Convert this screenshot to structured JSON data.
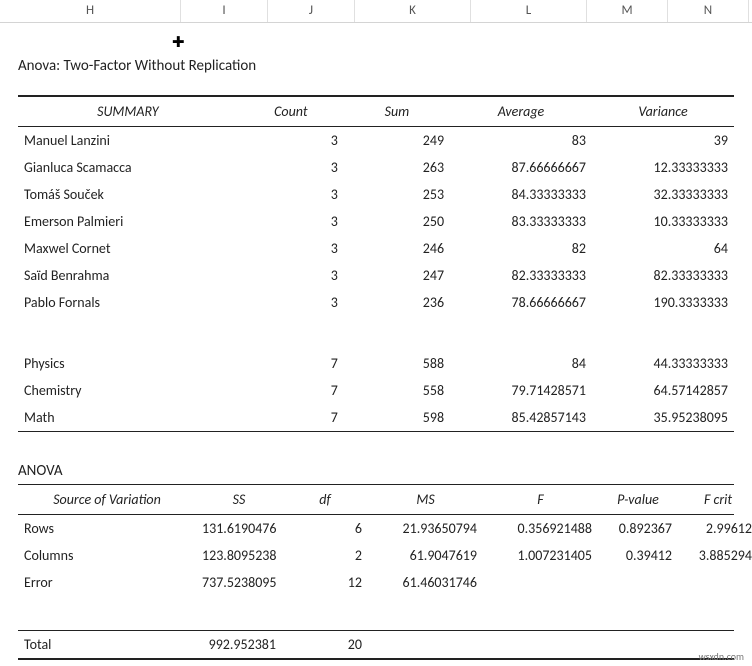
{
  "columns": {
    "H": "H",
    "I": "I",
    "J": "J",
    "K": "K",
    "L": "L",
    "M": "M",
    "N": "N"
  },
  "title": "Anova: Two-Factor Without Replication",
  "summary": {
    "headers": {
      "label": "SUMMARY",
      "count": "Count",
      "sum": "Sum",
      "avg": "Average",
      "var": "Variance"
    },
    "rows": [
      {
        "name": "Manuel Lanzini",
        "count": "3",
        "sum": "249",
        "avg": "83",
        "var": "39"
      },
      {
        "name": "Gianluca Scamacca",
        "count": "3",
        "sum": "263",
        "avg": "87.66666667",
        "var": "12.33333333"
      },
      {
        "name": "Tomáš Souček",
        "count": "3",
        "sum": "253",
        "avg": "84.33333333",
        "var": "32.33333333"
      },
      {
        "name": "Emerson Palmieri",
        "count": "3",
        "sum": "250",
        "avg": "83.33333333",
        "var": "10.33333333"
      },
      {
        "name": "Maxwel Cornet",
        "count": "3",
        "sum": "246",
        "avg": "82",
        "var": "64"
      },
      {
        "name": "Saïd Benrahma",
        "count": "3",
        "sum": "247",
        "avg": "82.33333333",
        "var": "82.33333333"
      },
      {
        "name": "Pablo Fornals",
        "count": "3",
        "sum": "236",
        "avg": "78.66666667",
        "var": "190.3333333"
      }
    ],
    "cols": [
      {
        "name": "Physics",
        "count": "7",
        "sum": "588",
        "avg": "84",
        "var": "44.33333333"
      },
      {
        "name": "Chemistry",
        "count": "7",
        "sum": "558",
        "avg": "79.71428571",
        "var": "64.57142857"
      },
      {
        "name": "Math",
        "count": "7",
        "sum": "598",
        "avg": "85.42857143",
        "var": "35.95238095"
      }
    ]
  },
  "anova": {
    "title": "ANOVA",
    "headers": {
      "src": "Source of Variation",
      "ss": "SS",
      "df": "df",
      "ms": "MS",
      "f": "F",
      "p": "P-value",
      "fcrit": "F crit"
    },
    "rows": [
      {
        "src": "Rows",
        "ss": "131.6190476",
        "df": "6",
        "ms": "21.93650794",
        "f": "0.356921488",
        "p": "0.892367",
        "fcrit": "2.99612"
      },
      {
        "src": "Columns",
        "ss": "123.8095238",
        "df": "2",
        "ms": "61.9047619",
        "f": "1.007231405",
        "p": "0.39412",
        "fcrit": "3.885294"
      },
      {
        "src": "Error",
        "ss": "737.5238095",
        "df": "12",
        "ms": "61.46031746",
        "f": "",
        "p": "",
        "fcrit": ""
      }
    ],
    "total": {
      "src": "Total",
      "ss": "992.952381",
      "df": "20"
    }
  },
  "watermark": "wsxdn.com"
}
